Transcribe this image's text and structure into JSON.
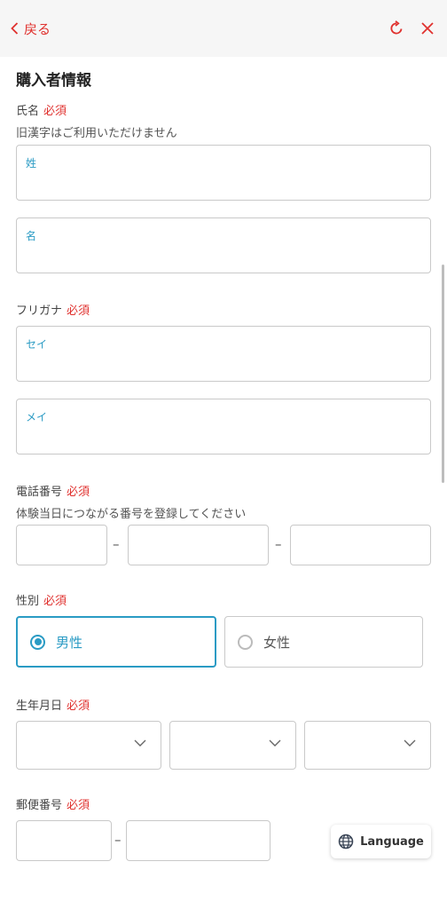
{
  "header": {
    "back_label": "戻る",
    "icons": [
      "chevron-left-icon",
      "refresh-icon",
      "close-icon"
    ],
    "accent_color": "#e0322f"
  },
  "section_title": "購入者情報",
  "required_label": "必須",
  "name": {
    "label": "氏名",
    "note": "旧漢字はご利用いただけません",
    "last_placeholder": "姓",
    "first_placeholder": "名"
  },
  "furigana": {
    "label": "フリガナ",
    "last_placeholder": "セイ",
    "first_placeholder": "メイ"
  },
  "phone": {
    "label": "電話番号",
    "note": "体験当日につながる番号を登録してください",
    "separator": "–"
  },
  "gender": {
    "label": "性別",
    "options": [
      "男性",
      "女性"
    ],
    "selected": "男性",
    "selected_color": "#2a9bc4"
  },
  "birthdate": {
    "label": "生年月日"
  },
  "postal": {
    "label": "郵便番号",
    "separator": "–"
  },
  "language_button": {
    "label": "Language",
    "icon": "globe-icon"
  }
}
